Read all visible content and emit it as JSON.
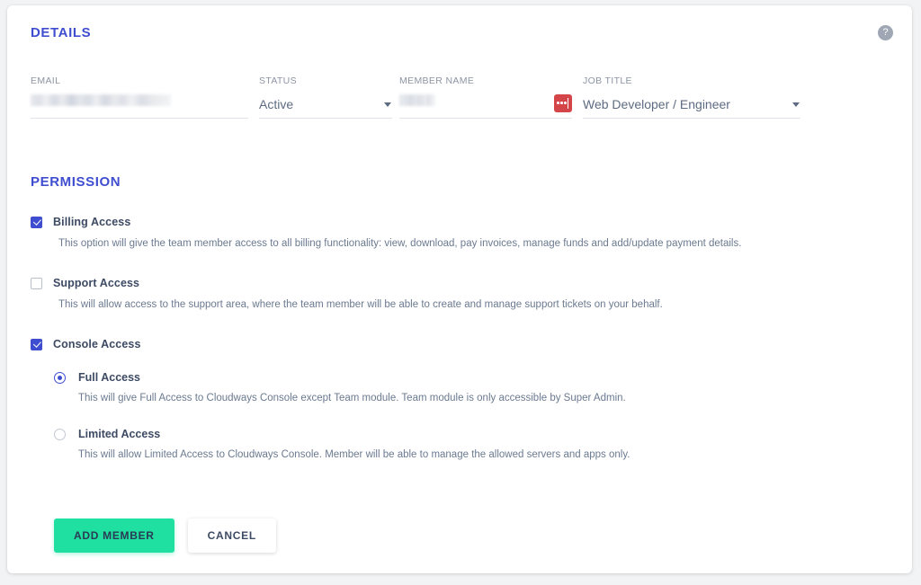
{
  "help": {
    "icon": "help-circle-icon",
    "glyph": "?"
  },
  "details": {
    "heading": "DETAILS",
    "fields": [
      {
        "label": "EMAIL",
        "value": "",
        "redacted": true,
        "type": "text"
      },
      {
        "label": "STATUS",
        "value": "Active",
        "redacted": false,
        "type": "select"
      },
      {
        "label": "MEMBER NAME",
        "value": "",
        "redacted": true,
        "type": "text"
      },
      {
        "label": "JOB TITLE",
        "value": "Web Developer / Engineer",
        "redacted": false,
        "type": "select"
      }
    ]
  },
  "permission": {
    "heading": "PERMISSION",
    "options": [
      {
        "title": "Billing Access",
        "checked": true,
        "description": "This option will give the team member access to all billing functionality: view, download, pay invoices, manage funds and add/update payment details."
      },
      {
        "title": "Support Access",
        "checked": false,
        "description": "This will allow access to the support area, where the team member will be able to create and manage support tickets on your behalf."
      },
      {
        "title": "Console Access",
        "checked": true,
        "description": ""
      }
    ],
    "console_radios": [
      {
        "title": "Full Access",
        "selected": true,
        "description": "This will give Full Access to Cloudways Console except Team module. Team module is only accessible by Super Admin."
      },
      {
        "title": "Limited Access",
        "selected": false,
        "description": "This will allow Limited Access to Cloudways Console. Member will be able to manage the allowed servers and apps only."
      }
    ]
  },
  "actions": {
    "primary_label": "ADD MEMBER",
    "secondary_label": "CANCEL"
  },
  "colors": {
    "heading_blue": "#3f4ed0",
    "accent_green": "#1fe0a0",
    "text_dark": "#3d4a63",
    "text_muted": "#6b7a90",
    "label_gray": "#8d95a3",
    "pwmgr_red": "#d4454a",
    "help_gray": "#9ea7b3"
  }
}
